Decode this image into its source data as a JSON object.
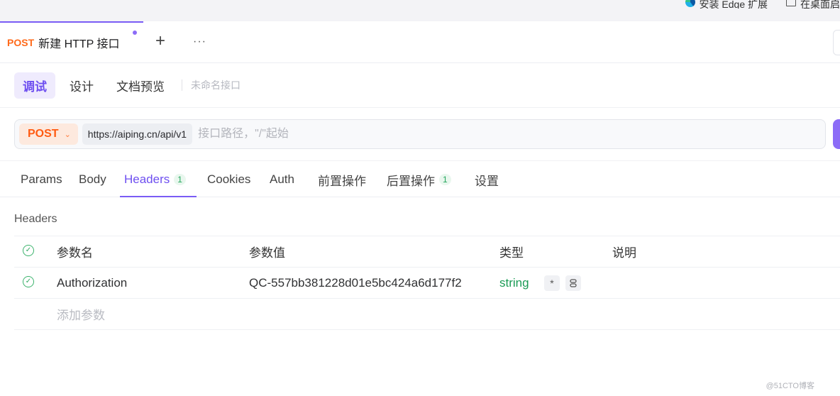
{
  "browser": {
    "install_edge_ext": "安装 Edge 扩展",
    "desktop": "在桌面启"
  },
  "tab": {
    "method": "POST",
    "title": "新建 HTTP 接口",
    "add": "+",
    "more": "···"
  },
  "subtabs": [
    "调试",
    "设计",
    "文档预览"
  ],
  "unnamed": "未命名接口",
  "request": {
    "method": "POST",
    "base_url": "https://aiping.cn/api/v1",
    "path_placeholder": "接口路径，\"/\"起始"
  },
  "req_tabs": [
    {
      "label": "Params",
      "badge": ""
    },
    {
      "label": "Body",
      "badge": ""
    },
    {
      "label": "Headers",
      "badge": "1"
    },
    {
      "label": "Cookies",
      "badge": ""
    },
    {
      "label": "Auth",
      "badge": ""
    },
    {
      "label": "前置操作",
      "badge": ""
    },
    {
      "label": "后置操作",
      "badge": "1"
    },
    {
      "label": "设置",
      "badge": ""
    }
  ],
  "headers_section": {
    "title": "Headers",
    "columns": [
      "参数名",
      "参数值",
      "类型",
      "说明"
    ],
    "rows": [
      {
        "name": "Authorization",
        "value": "QC-557bb381228d01e5bc424a6d177f2",
        "type": "string",
        "required": "*"
      }
    ],
    "add_placeholder": "添加参数"
  },
  "watermark": "@51CTO博客",
  "colors": {
    "accent": "#7a5cf5",
    "method": "#ff5b12",
    "type_green": "#1a9b55"
  }
}
